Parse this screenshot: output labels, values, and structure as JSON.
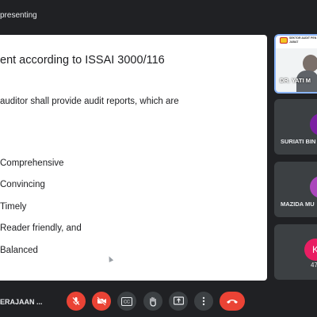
{
  "header": {
    "title": "presenting"
  },
  "slide": {
    "title": "ent according to ISSAI 3000/116",
    "intro": "auditor shall provide audit reports, which are",
    "bullets": [
      "Comprehensive",
      "Convincing",
      "Timely",
      "Reader friendly, and",
      "Balanced"
    ]
  },
  "participants": {
    "presenter": {
      "name": "DR. YATI M",
      "banner_lines": [
        "SEKTOR AUDIT PEN",
        "JABAT"
      ]
    },
    "tiles": [
      {
        "name": "SURIATI BIN",
        "avatar_color": "#7b1fa2"
      },
      {
        "name": "MAZIDA MU",
        "avatar_color": "#ab47bc"
      },
      {
        "avatar_letter": "K",
        "avatar_color": "#e91e63",
        "count": "47"
      }
    ]
  },
  "footer": {
    "meeting_name": "ERAJAAN ..."
  },
  "controls": {
    "mic": {
      "icon": "mic-off-icon",
      "state": "off",
      "color": "#ea4335"
    },
    "camera": {
      "icon": "camera-off-icon",
      "state": "off",
      "color": "#ea4335"
    },
    "captions": {
      "icon": "cc-icon",
      "label": "CC"
    },
    "raise_hand": {
      "icon": "hand-icon"
    },
    "present": {
      "icon": "present-icon"
    },
    "more": {
      "icon": "more-vert-icon"
    },
    "leave": {
      "icon": "end-call-icon",
      "color": "#ea4335"
    }
  }
}
